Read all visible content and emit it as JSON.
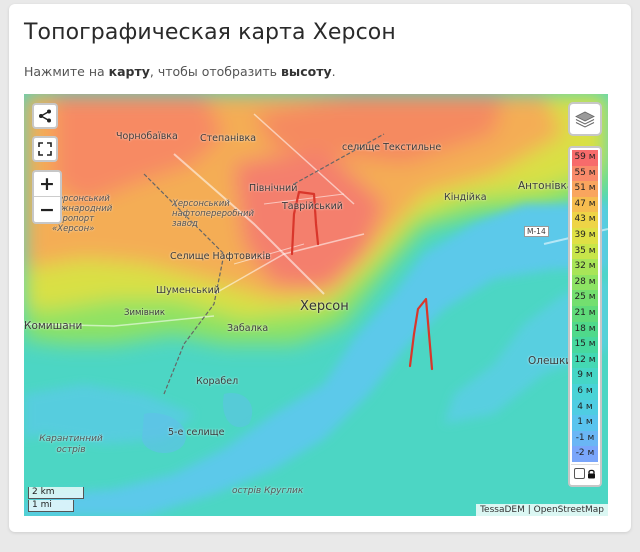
{
  "page": {
    "title": "Топографическая карта Херсон",
    "subtitle_parts": [
      "Нажмите на ",
      "карту",
      ", чтобы отобразить ",
      "высоту",
      "."
    ]
  },
  "map": {
    "controls": {
      "share_icon": "share-icon",
      "fullscreen_icon": "fullscreen-icon",
      "zoom_in_label": "+",
      "zoom_out_label": "−",
      "layers_icon": "layers-icon"
    },
    "legend": {
      "items": [
        {
          "label": "59 м",
          "color": "#f76b6b"
        },
        {
          "label": "55 м",
          "color": "#f98a6a"
        },
        {
          "label": "51 м",
          "color": "#f9a55e"
        },
        {
          "label": "47 м",
          "color": "#f6bd4f"
        },
        {
          "label": "43 м",
          "color": "#eed446"
        },
        {
          "label": "39 м",
          "color": "#dfe045"
        },
        {
          "label": "35 м",
          "color": "#c8e54a"
        },
        {
          "label": "32 м",
          "color": "#a8e558"
        },
        {
          "label": "28 м",
          "color": "#8de363"
        },
        {
          "label": "25 м",
          "color": "#73df6f"
        },
        {
          "label": "21 м",
          "color": "#5fdb7a"
        },
        {
          "label": "18 м",
          "color": "#4fd98b"
        },
        {
          "label": "15 м",
          "color": "#47d89e"
        },
        {
          "label": "12 м",
          "color": "#44d8b3"
        },
        {
          "label": "9 м",
          "color": "#45d6c6"
        },
        {
          "label": "6 м",
          "color": "#48d3d6"
        },
        {
          "label": "4 м",
          "color": "#4fcde3"
        },
        {
          "label": "1 м",
          "color": "#59c4ee"
        },
        {
          "label": "-1 м",
          "color": "#6ab6f5"
        },
        {
          "label": "-2 м",
          "color": "#7aa6fb"
        }
      ],
      "lock_icon": "lock-icon"
    },
    "places": {
      "chornobaivka": "Чорнобаївка",
      "stepanivka": "Степанівка",
      "tekstylne": "селище Текстильне",
      "pivnichnyi": "Північний",
      "tavriiskyi": "Таврійський",
      "kindiika": "Кіндійка",
      "antonivka": "Антонівка",
      "airport": "Херсонський міжнародний аеропорт «Херсон»",
      "refinery": "Херсонський нафтопереробний завод",
      "naftovykiv": "Селище Нафтовиків",
      "shumenskyi": "Шуменський",
      "zymivnyk": "Зимівник",
      "kherson": "Херсон",
      "zabalka": "Забалка",
      "komyshany": "Комишани",
      "korabel": "Корабел",
      "selyshche5": "5-е селище",
      "oleshky": "Олешки",
      "karantynnyi": "Карантинний острів",
      "kruhlyk": "острів Круглик",
      "m14": "М-14"
    },
    "scale": {
      "km": "2 km",
      "mi": "1 mi"
    },
    "attribution": "TessaDEM | OpenStreetMap"
  }
}
